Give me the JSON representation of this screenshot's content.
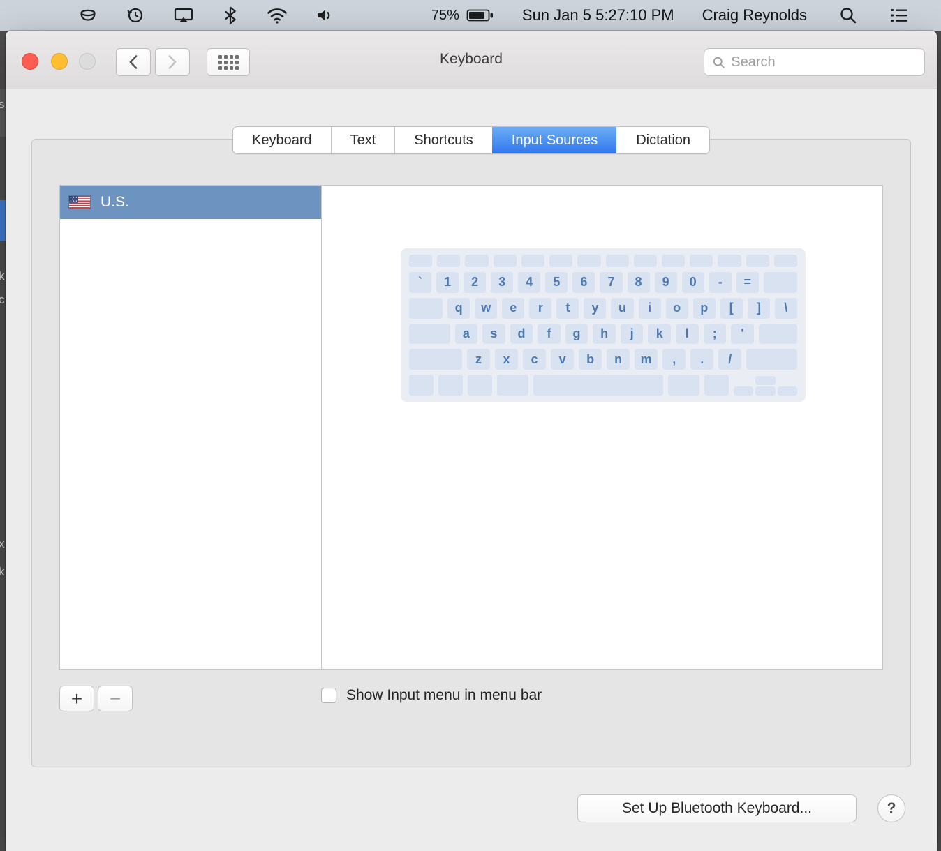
{
  "menu_bar": {
    "battery_percent": "75%",
    "clock": "Sun Jan 5 5:27:10 PM",
    "user_name": "Craig Reynolds",
    "icons": [
      "app-cup-icon",
      "time-machine-icon",
      "airplay-display-icon",
      "bluetooth-icon",
      "wifi-icon",
      "volume-icon",
      "battery-icon",
      "spotlight-icon",
      "notification-center-icon"
    ]
  },
  "background": {
    "strip_color": "#4e4e4e",
    "accent_patch_color": "#3f7fd6",
    "fragments": [
      {
        "t": "s"
      },
      {
        "t": "k"
      },
      {
        "t": "c"
      },
      {
        "t": "x"
      },
      {
        "t": "k"
      }
    ]
  },
  "window": {
    "title": "Keyboard",
    "search_placeholder": "Search"
  },
  "tabs": [
    {
      "label": "Keyboard",
      "selected": false
    },
    {
      "label": "Text",
      "selected": false
    },
    {
      "label": "Shortcuts",
      "selected": false
    },
    {
      "label": "Input Sources",
      "selected": true
    },
    {
      "label": "Dictation",
      "selected": false
    }
  ],
  "input_sources": {
    "items": [
      {
        "label": "U.S.",
        "selected": true,
        "flag": "us-flag"
      }
    ],
    "add_button": "+",
    "remove_button": "−",
    "show_input_menu_label": "Show Input menu in menu bar",
    "show_input_menu_checked": false
  },
  "keyboard_preview": {
    "rows": [
      {
        "keys": [
          [
            "",
            1
          ],
          [
            "",
            1
          ],
          [
            "",
            1
          ],
          [
            "",
            1
          ],
          [
            "",
            1
          ],
          [
            "",
            1
          ],
          [
            "",
            1
          ],
          [
            "",
            1
          ],
          [
            "",
            1
          ],
          [
            "",
            1
          ],
          [
            "",
            1
          ],
          [
            "",
            1
          ],
          [
            "",
            1
          ],
          [
            "",
            1
          ]
        ]
      },
      {
        "keys": [
          [
            "`",
            1
          ],
          [
            "1",
            1
          ],
          [
            "2",
            1
          ],
          [
            "3",
            1
          ],
          [
            "4",
            1
          ],
          [
            "5",
            1
          ],
          [
            "6",
            1
          ],
          [
            "7",
            1
          ],
          [
            "8",
            1
          ],
          [
            "9",
            1
          ],
          [
            "0",
            1
          ],
          [
            "-",
            1
          ],
          [
            "=",
            1
          ],
          [
            "",
            1.5
          ]
        ]
      },
      {
        "keys": [
          [
            "",
            1.5
          ],
          [
            "q",
            1
          ],
          [
            "w",
            1
          ],
          [
            "e",
            1
          ],
          [
            "r",
            1
          ],
          [
            "t",
            1
          ],
          [
            "y",
            1
          ],
          [
            "u",
            1
          ],
          [
            "i",
            1
          ],
          [
            "o",
            1
          ],
          [
            "p",
            1
          ],
          [
            "[",
            1
          ],
          [
            "]",
            1
          ],
          [
            "\\",
            1
          ]
        ]
      },
      {
        "keys": [
          [
            "",
            1.8
          ],
          [
            "a",
            1
          ],
          [
            "s",
            1
          ],
          [
            "d",
            1
          ],
          [
            "f",
            1
          ],
          [
            "g",
            1
          ],
          [
            "h",
            1
          ],
          [
            "j",
            1
          ],
          [
            "k",
            1
          ],
          [
            "l",
            1
          ],
          [
            ";",
            1
          ],
          [
            "'",
            1
          ],
          [
            "",
            1.7
          ]
        ]
      },
      {
        "keys": [
          [
            "",
            2.3
          ],
          [
            "z",
            1
          ],
          [
            "x",
            1
          ],
          [
            "c",
            1
          ],
          [
            "v",
            1
          ],
          [
            "b",
            1
          ],
          [
            "n",
            1
          ],
          [
            "m",
            1
          ],
          [
            ",",
            1
          ],
          [
            ".",
            1
          ],
          [
            "/",
            1
          ],
          [
            "",
            2.2
          ]
        ]
      },
      {
        "keys": [
          [
            "",
            1
          ],
          [
            "",
            1
          ],
          [
            "",
            1
          ],
          [
            "",
            1.3
          ],
          [
            "",
            5.3
          ],
          [
            "",
            1.3
          ],
          [
            "",
            1
          ],
          [
            "@arrows",
            2.6
          ]
        ]
      }
    ]
  },
  "footer": {
    "setup_bluetooth_label": "Set Up Bluetooth Keyboard...",
    "help_label": "?"
  },
  "colors": {
    "selected_tab_blue": "#3078ec",
    "selected_row_blue": "#6d94c1",
    "key_text_blue": "#4c79b2",
    "menu_bar_bg": "#ccd3db"
  }
}
